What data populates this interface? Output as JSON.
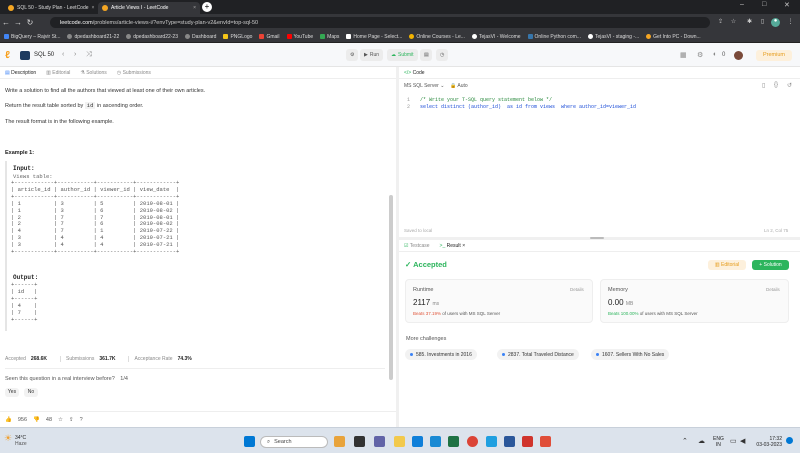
{
  "browser": {
    "tabs": [
      {
        "title": "SQL 50 - Study Plan - LeetCode"
      },
      {
        "title": "Article Views I - LeetCode"
      }
    ],
    "url_host": "leetcode.com",
    "url_path": "/problems/article-views-i/?envType=study-plan-v2&envId=top-sql-50",
    "bookmarks": [
      "BigQuery – Rajvir St...",
      "dpedashboard21-22",
      "dpedashboard22-23",
      "Dashboard",
      "PNGLogo",
      "Gmail",
      "YouTube",
      "Maps",
      "Home Page - Select...",
      "Online Courses - Le...",
      "TejasVI - Welcome",
      "Online Python com...",
      "TejasVI - staging -...",
      "Get Into PC - Down..."
    ]
  },
  "lc": {
    "list_title": "SQL 50",
    "run": "Run",
    "submit": "Submit",
    "streak": "0",
    "premium": "Premium"
  },
  "left": {
    "tabs": [
      "Description",
      "Editorial",
      "Solutions",
      "Submissions"
    ],
    "p1": "Write a solution to find all the authors that viewed at least one of their own articles.",
    "p2_pre": "Return the result table sorted by",
    "p2_code": "id",
    "p2_post": "in ascending order.",
    "p3": "The result format is in the following example.",
    "example_title": "Example 1:",
    "input_label": "Input:",
    "views_label": "Views table:",
    "views_table": "+------------+-----------+-----------+------------+\n| article_id | author_id | viewer_id | view_date  |\n+------------+-----------+-----------+------------+\n| 1          | 3         | 5         | 2019-08-01 |\n| 1          | 3         | 6         | 2019-08-02 |\n| 2          | 7         | 7         | 2019-08-01 |\n| 2          | 7         | 6         | 2019-08-02 |\n| 4          | 7         | 1         | 2019-07-22 |\n| 3          | 4         | 4         | 2019-07-21 |\n| 3          | 4         | 4         | 2019-07-21 |\n+------------+-----------+-----------+------------+",
    "output_label": "Output:",
    "output_table": "+------+\n| id   |\n+------+\n| 4    |\n| 7    |\n+------+",
    "accepted_label": "Accepted",
    "accepted_val": "268.6K",
    "submissions_label": "Submissions",
    "submissions_val": "361.7K",
    "rate_label": "Acceptance Rate",
    "rate_val": "74.3%",
    "interview_q": "Seen this question in a real interview before?",
    "interview_count": "1/4",
    "yes": "Yes",
    "no": "No",
    "likes": "956",
    "dislikes": "48"
  },
  "code": {
    "tab": "Code",
    "language": "MS SQL Server",
    "auto": "Auto",
    "line1": "/* Write your T-SQL query statement below */",
    "line2": "select distinct (author_id)  as id from views  where author_id=viewer_id",
    "saved": "Saved to local",
    "cursor": "Ln 2, Col 75"
  },
  "result": {
    "tab_testcase": "Testcase",
    "tab_result": "Result",
    "status": "Accepted",
    "editorial_btn": "Editorial",
    "solution_btn": "Solution",
    "runtime_label": "Runtime",
    "runtime_val": "2117",
    "runtime_unit": "ms",
    "runtime_beats_pct": "Beats 37.19%",
    "runtime_beats_rest": "of users with MS SQL Server",
    "memory_label": "Memory",
    "memory_val": "0.00",
    "memory_unit": "MB",
    "memory_beats_pct": "Beats 100.00%",
    "memory_beats_rest": "of users with MS SQL Server",
    "details": "Details",
    "more_title": "More challenges",
    "challenges": [
      "585. Investments in 2016",
      "2837. Total Traveled Distance",
      "1607. Sellers With No Sales"
    ]
  },
  "taskbar": {
    "temp": "34°C",
    "weather": "Haze",
    "search": "Search",
    "lang": "ENG",
    "region": "IN",
    "time": "17:32",
    "date": "03-03-2023"
  }
}
